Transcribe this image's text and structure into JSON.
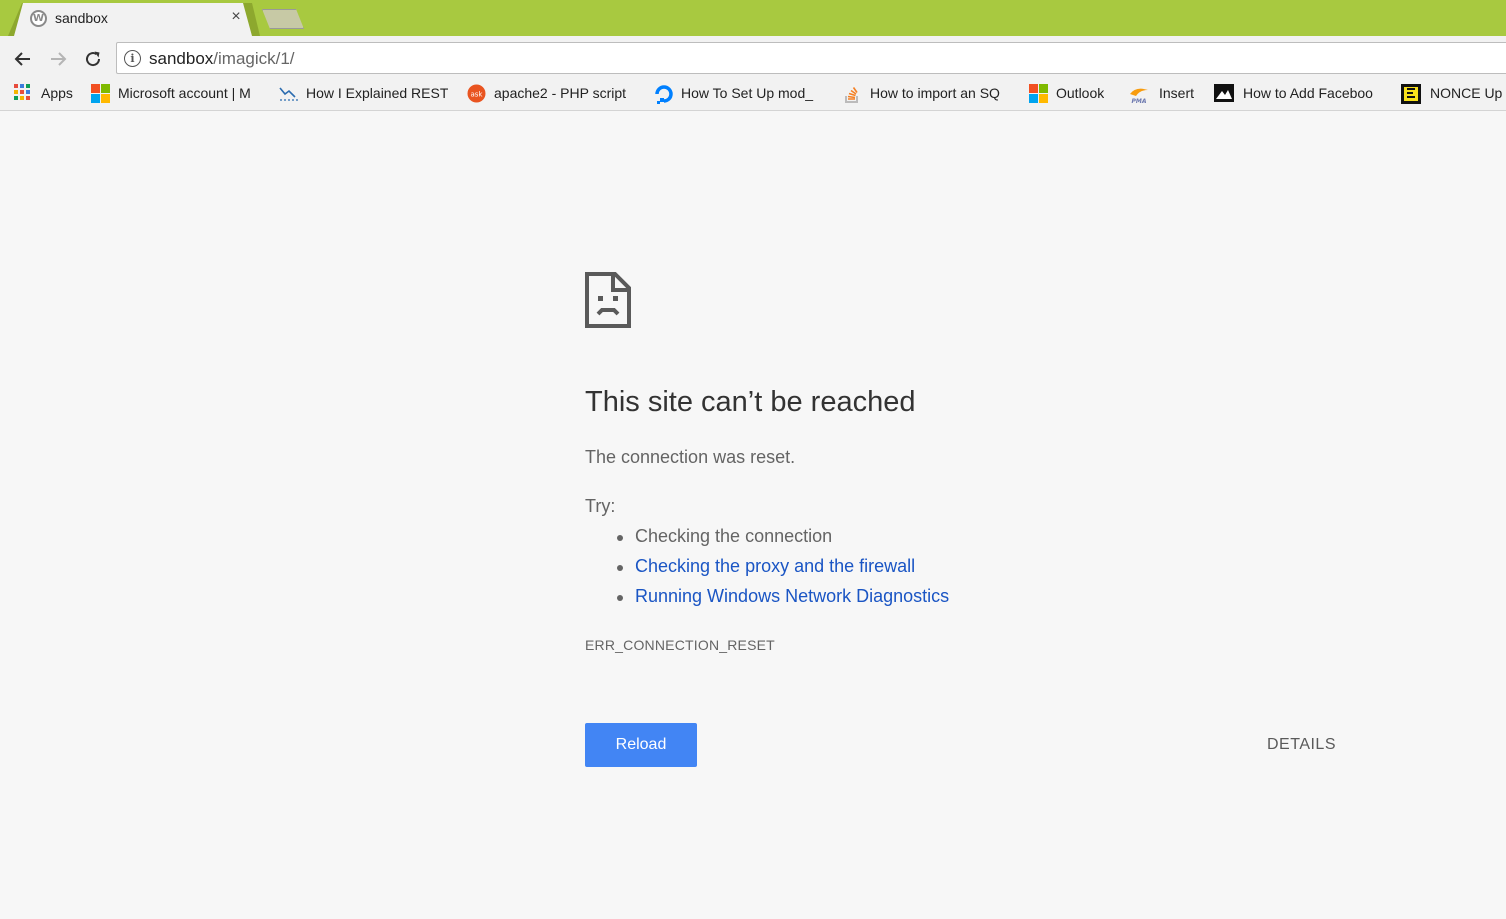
{
  "browser": {
    "tab": {
      "title": "sandbox",
      "close_glyph": "×",
      "favicon_letter": "W"
    },
    "url": {
      "host": "sandbox",
      "path": "/imagick/1/"
    },
    "bookmarks": [
      {
        "label": "Apps",
        "icon": "apps-grid-icon"
      },
      {
        "label": "Microsoft account | M",
        "icon": "microsoft-icon"
      },
      {
        "label": "How I Explained REST",
        "icon": "chart-icon"
      },
      {
        "label": "apache2 - PHP script",
        "icon": "askubuntu-icon"
      },
      {
        "label": "How To Set Up mod_",
        "icon": "digitalocean-icon"
      },
      {
        "label": "How to import an SQ",
        "icon": "stackoverflow-icon"
      },
      {
        "label": "Outlook",
        "icon": "microsoft-icon"
      },
      {
        "label": "Insert",
        "icon": "phpmyadmin-icon"
      },
      {
        "label": "How to Add Faceboo",
        "icon": "mountain-icon"
      },
      {
        "label": "NONCE Up",
        "icon": "nonce-icon"
      }
    ]
  },
  "error": {
    "title": "This site can’t be reached",
    "description": "The connection was reset.",
    "try_label": "Try:",
    "suggestions": [
      "Checking the connection",
      "Checking the proxy and the firewall",
      "Running Windows Network Diagnostics"
    ],
    "code": "ERR_CONNECTION_RESET",
    "reload_label": "Reload",
    "details_label": "DETAILS"
  },
  "colors": {
    "tabstrip": "#a8c940",
    "link": "#1a55c4",
    "button": "#4285f4"
  }
}
